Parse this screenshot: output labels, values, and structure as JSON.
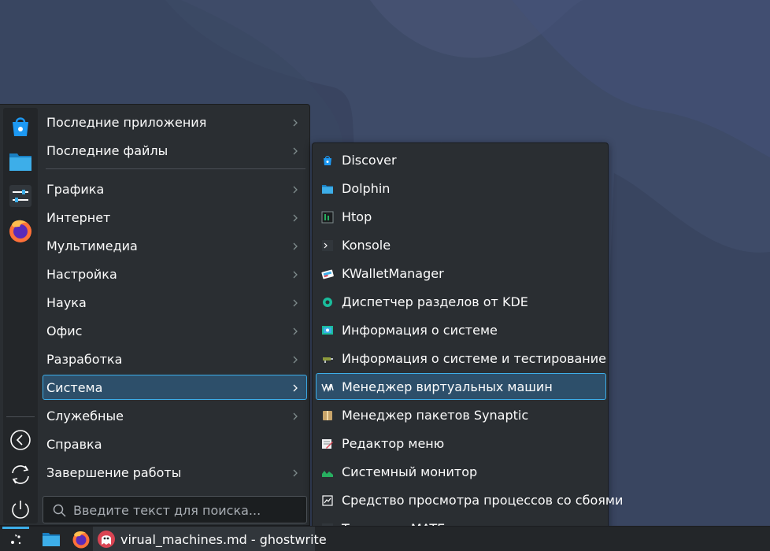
{
  "launcher": {
    "favorites": [
      {
        "icon": "discover-icon"
      },
      {
        "icon": "dolphin-folder-icon"
      },
      {
        "icon": "system-settings-icon"
      },
      {
        "icon": "firefox-icon"
      }
    ],
    "session": [
      {
        "icon": "leave-icon"
      },
      {
        "icon": "restart-icon"
      },
      {
        "icon": "shutdown-icon"
      }
    ],
    "categories": [
      {
        "label": "Последние приложения",
        "submenu": true
      },
      {
        "label": "Последние файлы",
        "submenu": true
      },
      {
        "label": "Графика",
        "submenu": true
      },
      {
        "label": "Интернет",
        "submenu": true
      },
      {
        "label": "Мультимедиа",
        "submenu": true
      },
      {
        "label": "Настройка",
        "submenu": true
      },
      {
        "label": "Наука",
        "submenu": true
      },
      {
        "label": "Офис",
        "submenu": true
      },
      {
        "label": "Разработка",
        "submenu": true
      },
      {
        "label": "Система",
        "submenu": true,
        "selected": true
      },
      {
        "label": "Служебные",
        "submenu": true
      },
      {
        "label": "Справка",
        "submenu": false
      },
      {
        "label": "Завершение работы",
        "submenu": true
      }
    ],
    "search": {
      "placeholder": "Введите текст для поиска..."
    }
  },
  "submenu": {
    "items": [
      {
        "label": "Discover",
        "icon": "discover-icon"
      },
      {
        "label": "Dolphin",
        "icon": "folder-icon"
      },
      {
        "label": "Htop",
        "icon": "htop-icon"
      },
      {
        "label": "Konsole",
        "icon": "terminal-icon"
      },
      {
        "label": "KWalletManager",
        "icon": "wallet-icon"
      },
      {
        "label": "Диспетчер разделов от KDE",
        "icon": "partition-icon"
      },
      {
        "label": "Информация о системе",
        "icon": "system-info-icon"
      },
      {
        "label": "Информация о системе и тестирование",
        "icon": "hardinfo-icon"
      },
      {
        "label": "Менеджер виртуальных машин",
        "icon": "virt-manager-icon",
        "selected": true
      },
      {
        "label": "Менеджер пакетов Synaptic",
        "icon": "package-icon"
      },
      {
        "label": "Редактор меню",
        "icon": "menu-editor-icon"
      },
      {
        "label": "Системный монитор",
        "icon": "system-monitor-icon"
      },
      {
        "label": "Средство просмотра процессов со сбоями",
        "icon": "crash-viewer-icon"
      },
      {
        "label": "Терминал MATE",
        "icon": "terminal-icon"
      }
    ]
  },
  "taskbar": {
    "task_label": "virual_machines.md - ghostwrite",
    "icons": [
      "app-launcher-icon",
      "folder-icon",
      "firefox-icon",
      "ghostwriter-icon"
    ]
  },
  "colors": {
    "accent": "#3daee9",
    "panel": "#2a2e32",
    "selection": "#2d4f6a"
  }
}
